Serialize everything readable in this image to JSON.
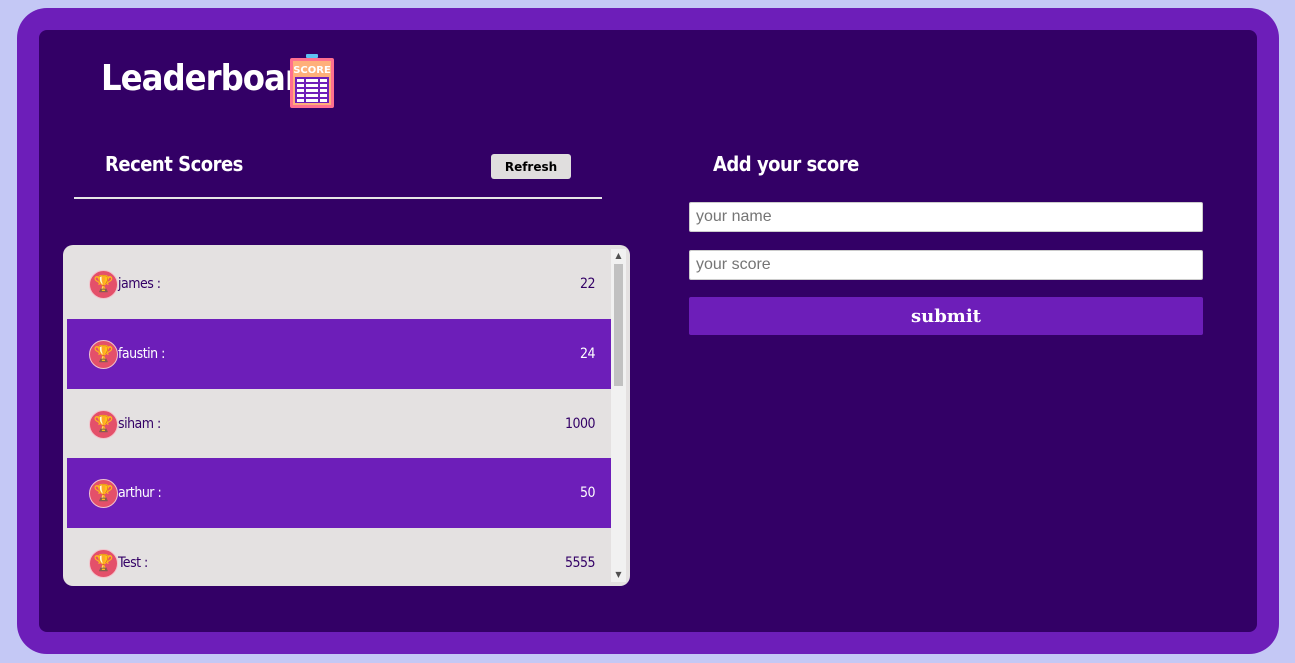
{
  "header": {
    "title": "Leaderboard",
    "icon": "score-board-icon",
    "icon_text": "SCORE"
  },
  "recent": {
    "heading": "Recent Scores",
    "refresh_label": "Refresh",
    "scores": [
      {
        "name": "james :",
        "score": "22",
        "style": "light"
      },
      {
        "name": "faustin :",
        "score": "24",
        "style": "dark"
      },
      {
        "name": "siham :",
        "score": "1000",
        "style": "light"
      },
      {
        "name": "arthur :",
        "score": "50",
        "style": "dark"
      },
      {
        "name": "Test :",
        "score": "5555",
        "style": "light"
      }
    ]
  },
  "form": {
    "heading": "Add your score",
    "name_placeholder": "your name",
    "score_placeholder": "your score",
    "submit_label": "submit"
  },
  "colors": {
    "page_bg": "#c4c8f5",
    "frame": "#6d1eb9",
    "panel": "#330066",
    "row_light": "#e4e1e1",
    "row_dark": "#6d1eb9",
    "trophy_badge": "#e4506a"
  }
}
